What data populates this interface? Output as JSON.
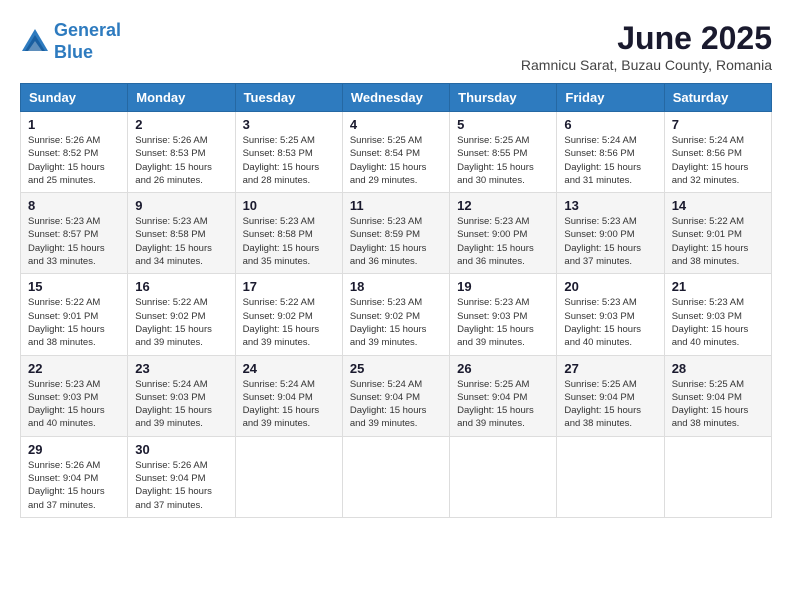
{
  "logo": {
    "line1": "General",
    "line2": "Blue"
  },
  "title": "June 2025",
  "subtitle": "Ramnicu Sarat, Buzau County, Romania",
  "headers": [
    "Sunday",
    "Monday",
    "Tuesday",
    "Wednesday",
    "Thursday",
    "Friday",
    "Saturday"
  ],
  "weeks": [
    [
      {
        "day": "1",
        "info": "Sunrise: 5:26 AM\nSunset: 8:52 PM\nDaylight: 15 hours\nand 25 minutes."
      },
      {
        "day": "2",
        "info": "Sunrise: 5:26 AM\nSunset: 8:53 PM\nDaylight: 15 hours\nand 26 minutes."
      },
      {
        "day": "3",
        "info": "Sunrise: 5:25 AM\nSunset: 8:53 PM\nDaylight: 15 hours\nand 28 minutes."
      },
      {
        "day": "4",
        "info": "Sunrise: 5:25 AM\nSunset: 8:54 PM\nDaylight: 15 hours\nand 29 minutes."
      },
      {
        "day": "5",
        "info": "Sunrise: 5:25 AM\nSunset: 8:55 PM\nDaylight: 15 hours\nand 30 minutes."
      },
      {
        "day": "6",
        "info": "Sunrise: 5:24 AM\nSunset: 8:56 PM\nDaylight: 15 hours\nand 31 minutes."
      },
      {
        "day": "7",
        "info": "Sunrise: 5:24 AM\nSunset: 8:56 PM\nDaylight: 15 hours\nand 32 minutes."
      }
    ],
    [
      {
        "day": "8",
        "info": "Sunrise: 5:23 AM\nSunset: 8:57 PM\nDaylight: 15 hours\nand 33 minutes."
      },
      {
        "day": "9",
        "info": "Sunrise: 5:23 AM\nSunset: 8:58 PM\nDaylight: 15 hours\nand 34 minutes."
      },
      {
        "day": "10",
        "info": "Sunrise: 5:23 AM\nSunset: 8:58 PM\nDaylight: 15 hours\nand 35 minutes."
      },
      {
        "day": "11",
        "info": "Sunrise: 5:23 AM\nSunset: 8:59 PM\nDaylight: 15 hours\nand 36 minutes."
      },
      {
        "day": "12",
        "info": "Sunrise: 5:23 AM\nSunset: 9:00 PM\nDaylight: 15 hours\nand 36 minutes."
      },
      {
        "day": "13",
        "info": "Sunrise: 5:23 AM\nSunset: 9:00 PM\nDaylight: 15 hours\nand 37 minutes."
      },
      {
        "day": "14",
        "info": "Sunrise: 5:22 AM\nSunset: 9:01 PM\nDaylight: 15 hours\nand 38 minutes."
      }
    ],
    [
      {
        "day": "15",
        "info": "Sunrise: 5:22 AM\nSunset: 9:01 PM\nDaylight: 15 hours\nand 38 minutes."
      },
      {
        "day": "16",
        "info": "Sunrise: 5:22 AM\nSunset: 9:02 PM\nDaylight: 15 hours\nand 39 minutes."
      },
      {
        "day": "17",
        "info": "Sunrise: 5:22 AM\nSunset: 9:02 PM\nDaylight: 15 hours\nand 39 minutes."
      },
      {
        "day": "18",
        "info": "Sunrise: 5:23 AM\nSunset: 9:02 PM\nDaylight: 15 hours\nand 39 minutes."
      },
      {
        "day": "19",
        "info": "Sunrise: 5:23 AM\nSunset: 9:03 PM\nDaylight: 15 hours\nand 39 minutes."
      },
      {
        "day": "20",
        "info": "Sunrise: 5:23 AM\nSunset: 9:03 PM\nDaylight: 15 hours\nand 40 minutes."
      },
      {
        "day": "21",
        "info": "Sunrise: 5:23 AM\nSunset: 9:03 PM\nDaylight: 15 hours\nand 40 minutes."
      }
    ],
    [
      {
        "day": "22",
        "info": "Sunrise: 5:23 AM\nSunset: 9:03 PM\nDaylight: 15 hours\nand 40 minutes."
      },
      {
        "day": "23",
        "info": "Sunrise: 5:24 AM\nSunset: 9:03 PM\nDaylight: 15 hours\nand 39 minutes."
      },
      {
        "day": "24",
        "info": "Sunrise: 5:24 AM\nSunset: 9:04 PM\nDaylight: 15 hours\nand 39 minutes."
      },
      {
        "day": "25",
        "info": "Sunrise: 5:24 AM\nSunset: 9:04 PM\nDaylight: 15 hours\nand 39 minutes."
      },
      {
        "day": "26",
        "info": "Sunrise: 5:25 AM\nSunset: 9:04 PM\nDaylight: 15 hours\nand 39 minutes."
      },
      {
        "day": "27",
        "info": "Sunrise: 5:25 AM\nSunset: 9:04 PM\nDaylight: 15 hours\nand 38 minutes."
      },
      {
        "day": "28",
        "info": "Sunrise: 5:25 AM\nSunset: 9:04 PM\nDaylight: 15 hours\nand 38 minutes."
      }
    ],
    [
      {
        "day": "29",
        "info": "Sunrise: 5:26 AM\nSunset: 9:04 PM\nDaylight: 15 hours\nand 37 minutes."
      },
      {
        "day": "30",
        "info": "Sunrise: 5:26 AM\nSunset: 9:04 PM\nDaylight: 15 hours\nand 37 minutes."
      },
      {
        "day": "",
        "info": ""
      },
      {
        "day": "",
        "info": ""
      },
      {
        "day": "",
        "info": ""
      },
      {
        "day": "",
        "info": ""
      },
      {
        "day": "",
        "info": ""
      }
    ]
  ]
}
